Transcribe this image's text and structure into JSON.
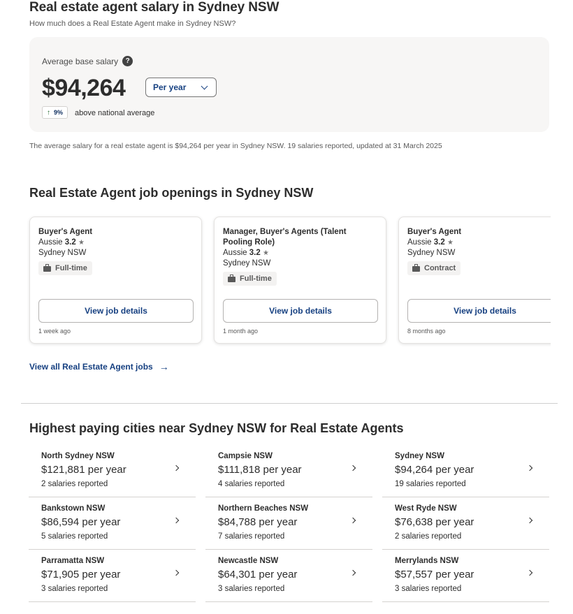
{
  "header": {
    "title": "Real estate agent salary in Sydney NSW",
    "subtitle": "How much does a Real Estate Agent make in Sydney NSW?"
  },
  "salary": {
    "label": "Average base salary",
    "help_icon": "question-circle-icon",
    "amount": "$94,264",
    "period": "Per year",
    "compare_pct": "9%",
    "compare_text": "above national average",
    "summary": "The average salary for a real estate agent is $94,264 per year in Sydney NSW.  19 salaries reported, updated at 31 March 2025"
  },
  "jobs": {
    "section_title": "Real Estate Agent job openings in Sydney NSW",
    "button_label": "View job details",
    "items": [
      {
        "title": "Buyer's Agent",
        "company": "Aussie",
        "rating": "3.2",
        "location": "Sydney NSW",
        "type": "Full-time",
        "age": "1 week ago"
      },
      {
        "title": "Manager, Buyer's Agents (Talent Pooling Role)",
        "company": "Aussie",
        "rating": "3.2",
        "location": "Sydney NSW",
        "type": "Full-time",
        "age": "1 month ago"
      },
      {
        "title": "Buyer's Agent",
        "company": "Aussie",
        "rating": "3.2",
        "location": "Sydney NSW",
        "type": "Contract",
        "age": "8 months ago"
      }
    ],
    "view_all": "View all Real Estate Agent jobs"
  },
  "cities": {
    "section_title": "Highest paying cities near Sydney NSW for Real Estate Agents",
    "items": [
      {
        "name": "North Sydney NSW",
        "salary": "$121,881 per year",
        "count": "2 salaries reported"
      },
      {
        "name": "Campsie NSW",
        "salary": "$111,818 per year",
        "count": "4 salaries reported"
      },
      {
        "name": "Sydney NSW",
        "salary": "$94,264 per year",
        "count": "19 salaries reported"
      },
      {
        "name": "Bankstown NSW",
        "salary": "$86,594 per year",
        "count": "5 salaries reported"
      },
      {
        "name": "Northern Beaches NSW",
        "salary": "$84,788 per year",
        "count": "7 salaries reported"
      },
      {
        "name": "West Ryde NSW",
        "salary": "$76,638 per year",
        "count": "2 salaries reported"
      },
      {
        "name": "Parramatta NSW",
        "salary": "$71,905 per year",
        "count": "3 salaries reported"
      },
      {
        "name": "Newcastle NSW",
        "salary": "$64,301 per year",
        "count": "3 salaries reported"
      },
      {
        "name": "Merrylands NSW",
        "salary": "$57,557 per year",
        "count": "3 salaries reported"
      }
    ]
  }
}
